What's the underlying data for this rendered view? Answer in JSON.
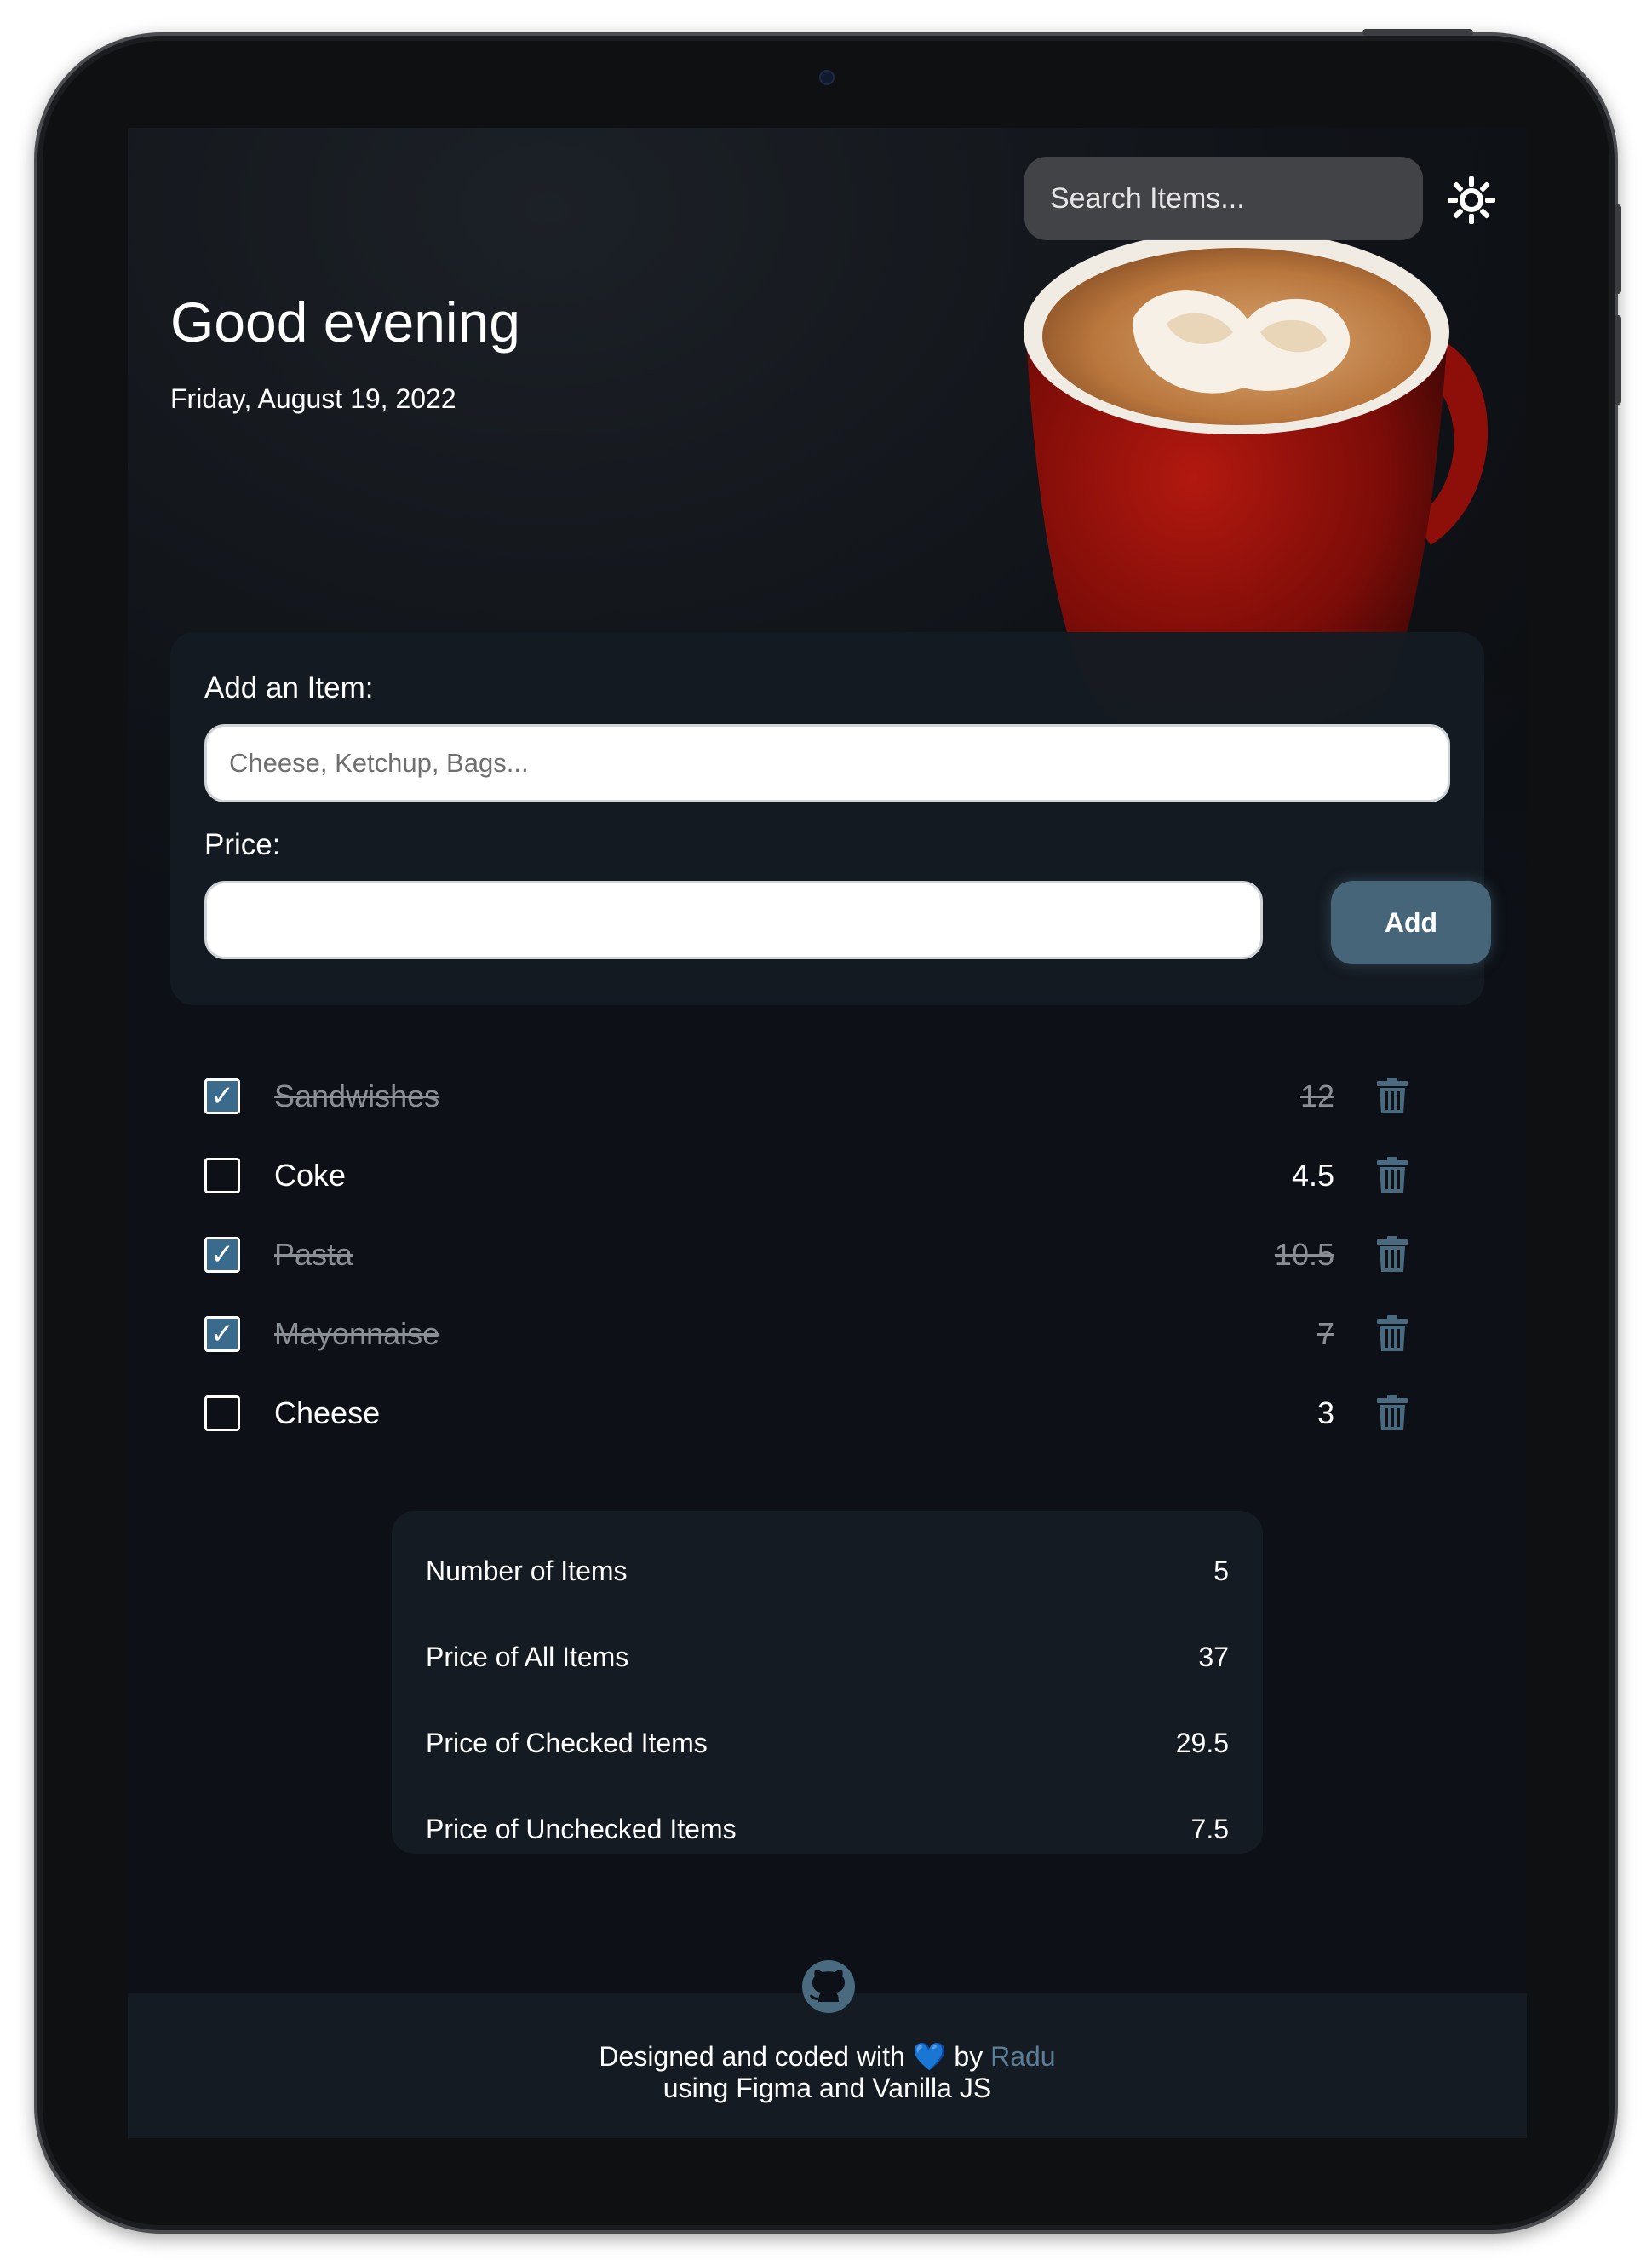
{
  "header": {
    "search_placeholder": "Search Items...",
    "search_icon": "search-icon",
    "theme_icon": "sun-icon"
  },
  "hero": {
    "greeting": "Good evening",
    "date": "Friday, August 19, 2022"
  },
  "add_form": {
    "item_label": "Add an Item:",
    "item_placeholder": "Cheese, Ketchup, Bags...",
    "price_label": "Price:",
    "price_value": "",
    "add_label": "Add"
  },
  "items": [
    {
      "name": "Sandwishes",
      "price": "12",
      "checked": true
    },
    {
      "name": "Coke",
      "price": "4.5",
      "checked": false
    },
    {
      "name": "Pasta",
      "price": "10.5",
      "checked": true
    },
    {
      "name": "Mayonnaise",
      "price": "7",
      "checked": true
    },
    {
      "name": "Cheese",
      "price": "3",
      "checked": false
    }
  ],
  "stats": [
    {
      "label": "Number of Items",
      "value": "5"
    },
    {
      "label": "Price of All Items",
      "value": "37"
    },
    {
      "label": "Price of Checked Items",
      "value": "29.5"
    },
    {
      "label": "Price of Unchecked Items",
      "value": "7.5"
    }
  ],
  "footer": {
    "line1_prefix": "Designed and coded with",
    "heart": "💙",
    "line1_by": "by",
    "author": "Radu",
    "line2": "using Figma and Vanilla JS"
  },
  "colors": {
    "accent": "#476578",
    "checkbox_checked": "#3a6a8c",
    "card_bg": "#151b22",
    "page_bg": "#0d1117",
    "link": "#5a7f98"
  }
}
